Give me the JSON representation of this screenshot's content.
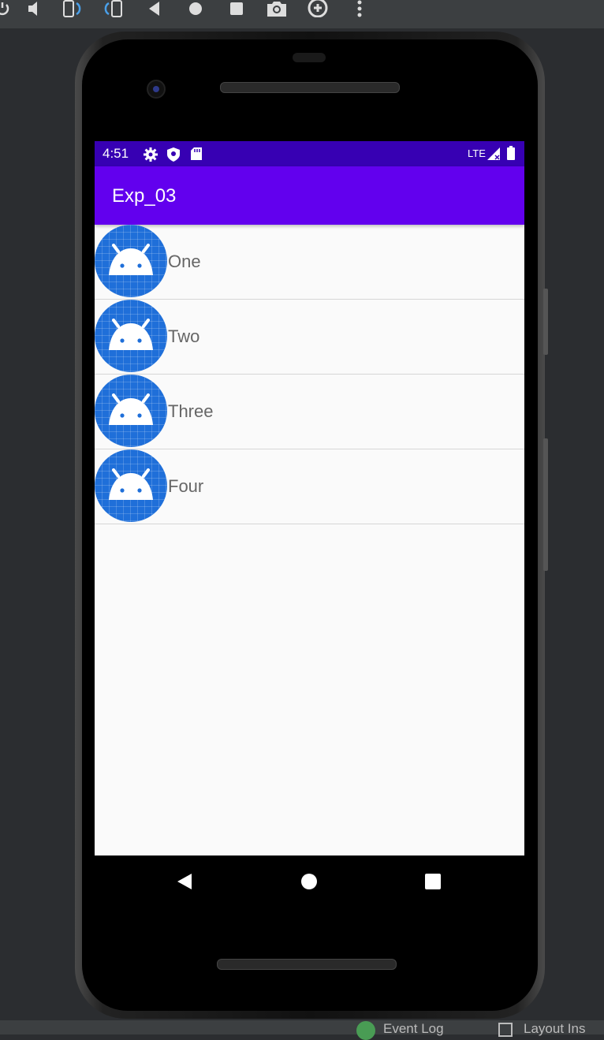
{
  "toolbar": {
    "icons": [
      "power-icon",
      "volume-down-icon",
      "rotate-left-icon",
      "rotate-right-icon",
      "back-icon",
      "home-icon",
      "overview-icon",
      "screenshot-icon",
      "zoom-icon",
      "more-icon"
    ]
  },
  "status_bar": {
    "time": "4:51",
    "network": "LTE",
    "icons": [
      "settings-icon",
      "shield-icon",
      "sd-card-icon",
      "signal-icon",
      "battery-icon"
    ]
  },
  "app_bar": {
    "title": "Exp_03"
  },
  "list": {
    "items": [
      {
        "label": "One"
      },
      {
        "label": "Two"
      },
      {
        "label": "Three"
      },
      {
        "label": "Four"
      }
    ]
  },
  "nav_bar": {
    "icons": [
      "nav-back-icon",
      "nav-home-icon",
      "nav-recents-icon"
    ]
  },
  "ide_bottom": {
    "event_log": "Event Log",
    "layout_inspector": "Layout Ins"
  },
  "colors": {
    "status_bar": "#3700b3",
    "app_bar": "#6200ee",
    "icon_bg": "#1f6fd9",
    "list_text": "#666666"
  }
}
